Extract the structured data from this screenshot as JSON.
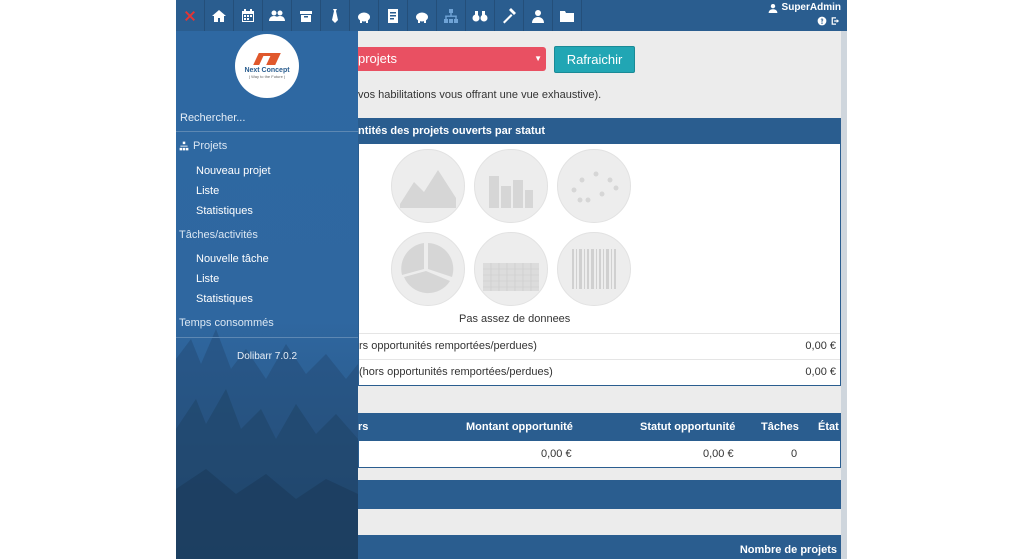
{
  "topbar": {
    "menu_icons": [
      "close-icon",
      "home-icon",
      "calendar-icon",
      "users-icon",
      "box-icon",
      "tie-icon",
      "piggy-bank-icon",
      "invoice-icon",
      "piggy-bank-icon",
      "sitemap-icon",
      "binoculars-icon",
      "hammer-icon",
      "person-icon",
      "folder-icon"
    ],
    "user": "SuperAdmin"
  },
  "sidebar": {
    "search": "Rechercher...",
    "projets": "Projets",
    "nouveau_projet": "Nouveau projet",
    "liste1": "Liste",
    "statistiques1": "Statistiques",
    "taches": "Tâches/activités",
    "nouvelle_tache": "Nouvelle tâche",
    "liste2": "Liste",
    "statistiques2": "Statistiques",
    "temps": "Temps consommés",
    "version": "Dolibarr 7.0.2",
    "logo_brand": "Next Concept",
    "logo_tag": "( Way to the Future )"
  },
  "main": {
    "select_value": "projets",
    "refresh_label": "Rafraichir",
    "description": "vos habilitations vous offrant une vue exhaustive).",
    "box1_title": "ntités des projets ouverts par statut",
    "no_data": "Pas assez de donnees",
    "row1_label": "rs opportunités remportées/perdues)",
    "row1_value": "0,00 €",
    "row2_label": "(hors opportunités remportées/perdues)",
    "row2_value": "0,00 €",
    "table_headers": {
      "c0": "rs",
      "c1": "Montant opportunité",
      "c2": "Statut opportunité",
      "c3": "Tâches",
      "c4": "État"
    },
    "table_row": {
      "c1": "0,00 €",
      "c2": "0,00 €",
      "c3": "0"
    },
    "box4_header": "Nombre de projets"
  },
  "colors": {
    "topbar": "#2a5d8f",
    "select": "#e95062",
    "refresh": "#21a6b4",
    "close": "#e43535"
  }
}
